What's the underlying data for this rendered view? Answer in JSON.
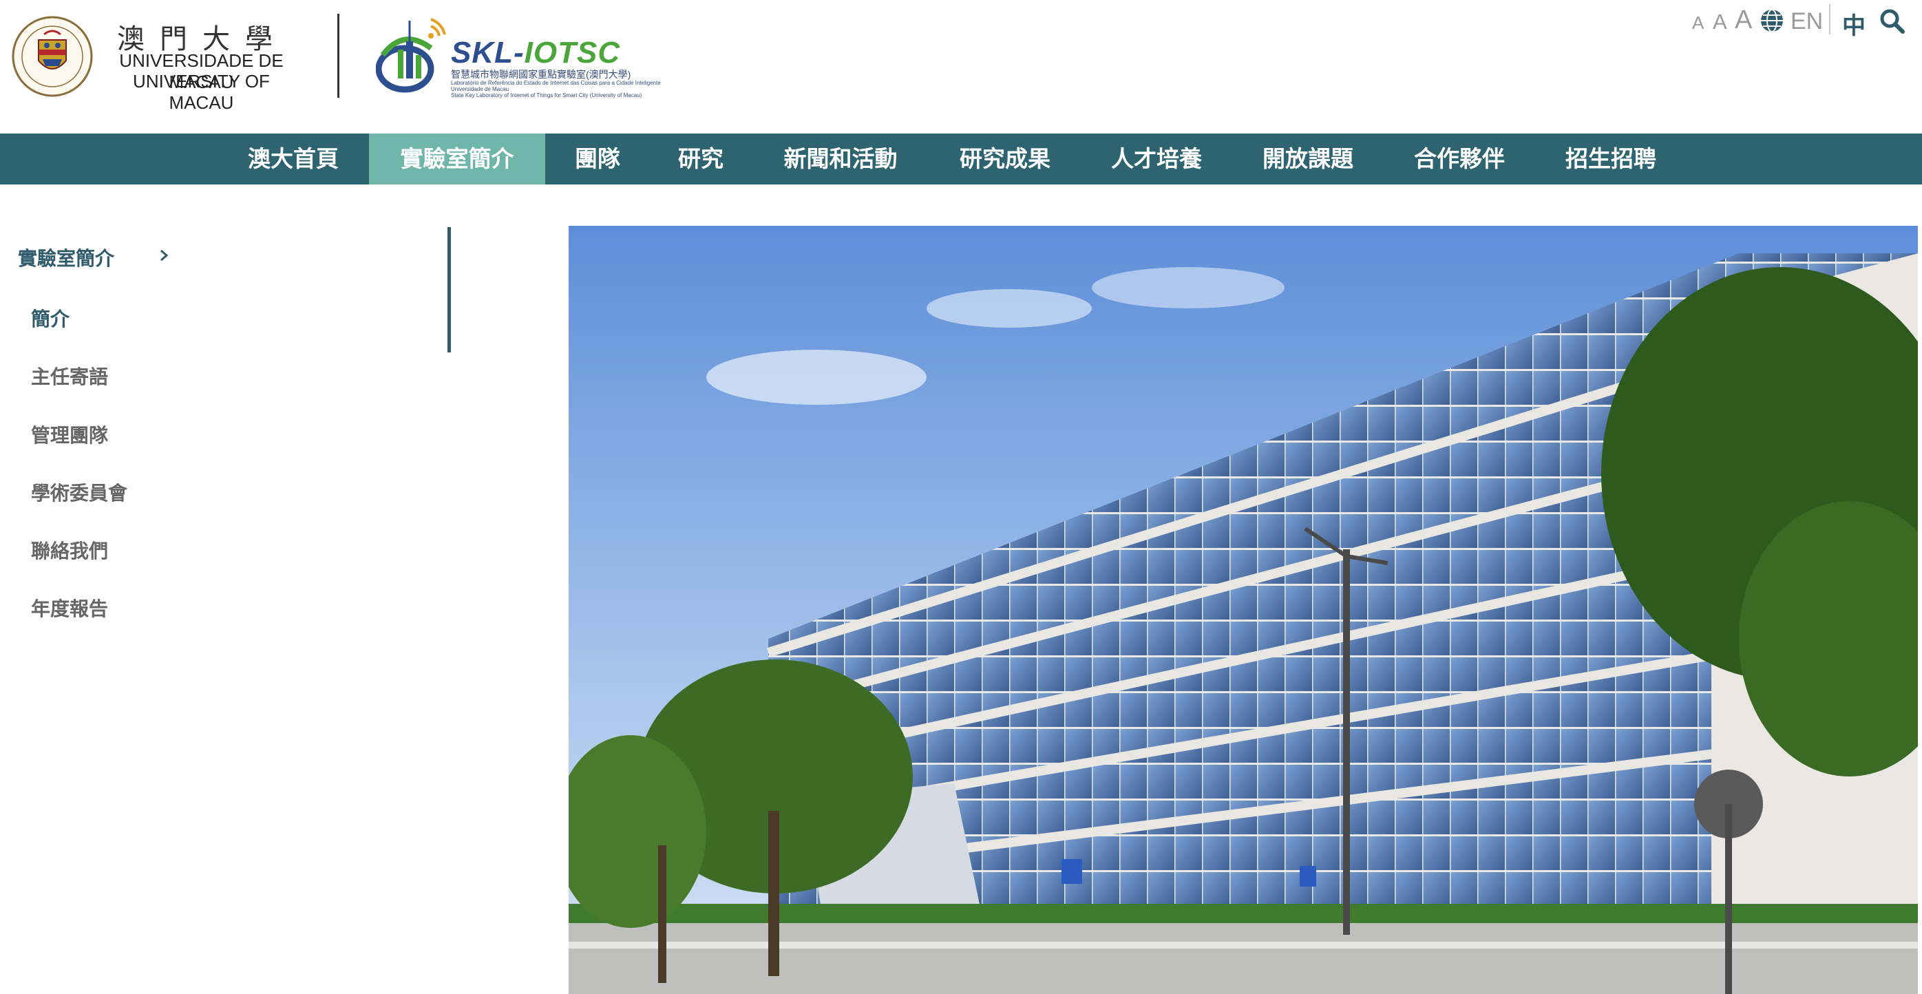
{
  "header": {
    "um_name_cn": "澳門大學",
    "um_name_pt": "UNIVERSIDADE DE MACAU",
    "um_name_en": "UNIVERSITY OF MACAU",
    "lab_logo": {
      "wordmark_skl": "SKL",
      "wordmark_dash": "-",
      "wordmark_iotsc": "IOTSC",
      "sub_cn": "智慧城市物聯網國家重點實驗室(澳門大學)",
      "sub_pt": "Laboratório de Referência do Estado de Internet das Coisas para a Cidade Inteligente",
      "sub_pt2": "Universidade de Macau",
      "sub_en": "State Key Laboratory of Internet of Things for Smart City (University of Macau)"
    },
    "tools": {
      "font_small": "A",
      "font_medium": "A",
      "font_large": "A",
      "lang_en": "EN",
      "lang_zh": "中",
      "globe_icon": "globe-icon",
      "search_icon": "search-icon"
    }
  },
  "nav": {
    "items": [
      {
        "label": "澳大首頁"
      },
      {
        "label": "實驗室簡介",
        "active": true
      },
      {
        "label": "團隊"
      },
      {
        "label": "研究"
      },
      {
        "label": "新聞和活動"
      },
      {
        "label": "研究成果"
      },
      {
        "label": "人才培養"
      },
      {
        "label": "開放課題"
      },
      {
        "label": "合作夥伴"
      },
      {
        "label": "招生招聘"
      }
    ]
  },
  "sidebar": {
    "title": "實驗室簡介",
    "items": [
      {
        "label": "簡介",
        "current": true
      },
      {
        "label": "主任寄語"
      },
      {
        "label": "管理團隊"
      },
      {
        "label": "學術委員會"
      },
      {
        "label": "聯絡我們"
      },
      {
        "label": "年度報告"
      }
    ]
  },
  "colors": {
    "nav_bg": "#2d6470",
    "nav_active": "#6fb5a9",
    "accent_teal": "#2f5b6b",
    "logo_blue": "#2e4f8f",
    "logo_green": "#4aa63b"
  }
}
